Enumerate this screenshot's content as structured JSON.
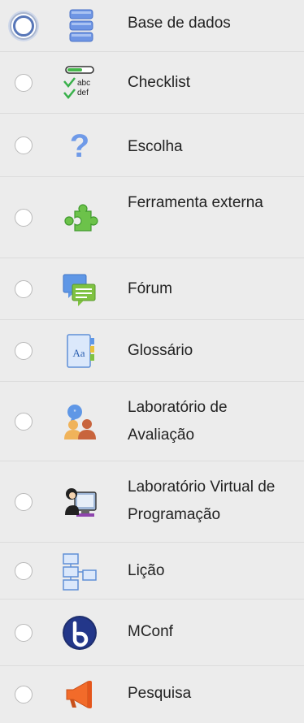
{
  "activities": [
    {
      "label": "Base de dados",
      "icon": "database-icon",
      "selected": true
    },
    {
      "label": "Checklist",
      "icon": "checklist-icon",
      "selected": false
    },
    {
      "label": "Escolha",
      "icon": "question-mark-icon",
      "selected": false
    },
    {
      "label": "Ferramenta externa",
      "icon": "puzzle-piece-icon",
      "selected": false
    },
    {
      "label": "Fórum",
      "icon": "chat-bubbles-icon",
      "selected": false
    },
    {
      "label": "Glossário",
      "icon": "glossary-book-icon",
      "selected": false
    },
    {
      "label": "Laboratório de Avaliação",
      "icon": "people-speech-icon",
      "selected": false
    },
    {
      "label": "Laboratório Virtual de Programação",
      "icon": "computer-user-icon",
      "selected": false
    },
    {
      "label": "Lição",
      "icon": "flowchart-icon",
      "selected": false
    },
    {
      "label": "MConf",
      "icon": "mconf-logo-icon",
      "selected": false
    },
    {
      "label": "Pesquisa",
      "icon": "megaphone-icon",
      "selected": false
    }
  ],
  "colors": {
    "background": "#ececec",
    "divider": "#dcdcdc",
    "focus_ring": "#5877b8",
    "text": "#222222"
  }
}
